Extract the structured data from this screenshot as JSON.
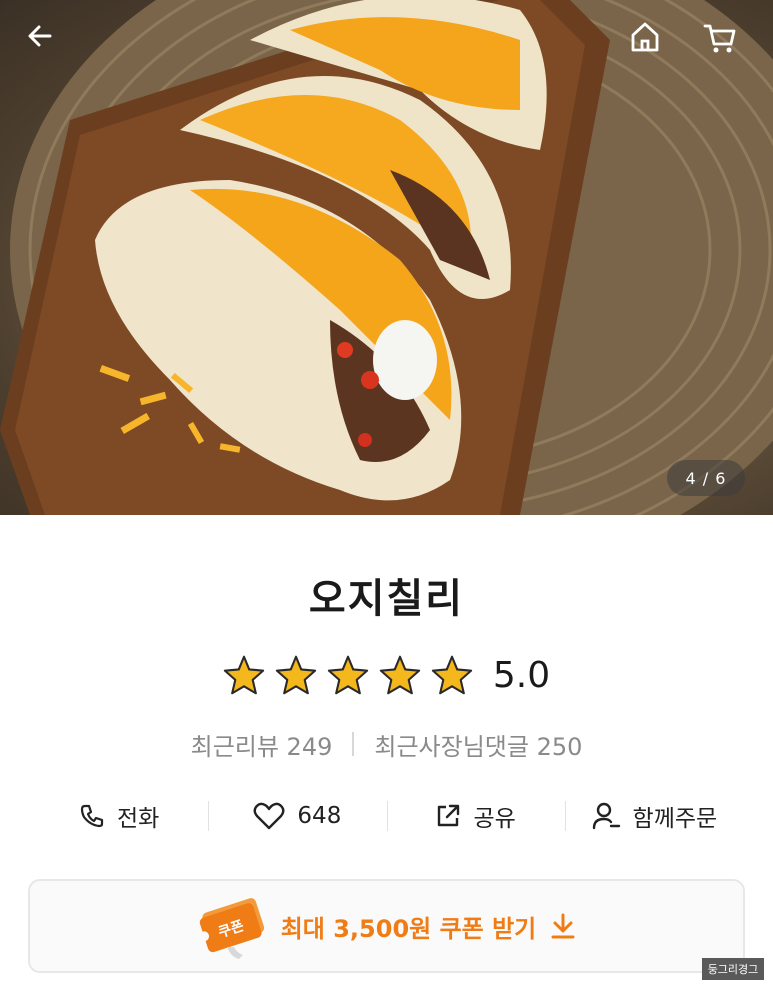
{
  "hero": {
    "image": "tacos-on-wooden-board-photo",
    "page_indicator": "4 / 6",
    "back_icon": "arrow-left-icon",
    "home_icon": "home-icon",
    "cart_icon": "cart-icon"
  },
  "store": {
    "name": "오지칠리",
    "rating": 5.0,
    "rating_text": "5.0",
    "stars": 5,
    "recent_reviews_label": "최근리뷰 249",
    "recent_owner_replies_label": "최근사장님댓글 250"
  },
  "actions": {
    "call_label": "전화",
    "like_count": "648",
    "share_label": "공유",
    "group_order_label": "함께주문"
  },
  "coupon": {
    "badge_text": "쿠폰",
    "label": "최대 3,500원 쿠폰 받기",
    "icon": "download-arrow-icon"
  },
  "watermark": {
    "text": "둥그리경그"
  },
  "colors": {
    "accent": "#f07c16",
    "star": "#f5b81c",
    "text": "#222222",
    "muted": "#8a8a8a"
  }
}
